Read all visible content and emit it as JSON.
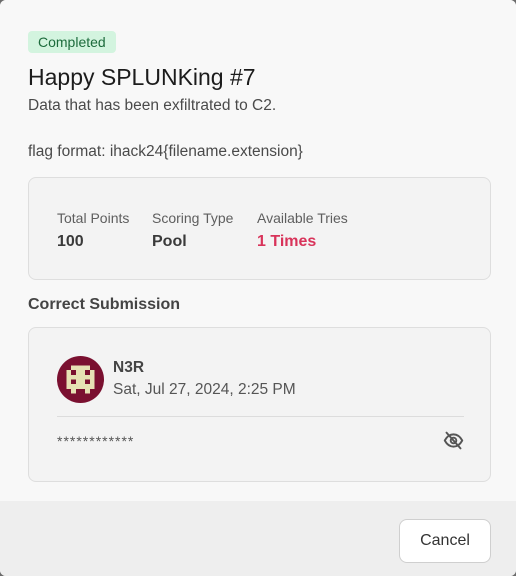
{
  "challenge": {
    "status_badge": "Completed",
    "title": "Happy SPLUNKing #7",
    "description": "Data that has been exfiltrated to C2.",
    "flag_format": "flag format: ihack24{filename.extension}"
  },
  "stats": {
    "total_points": {
      "label": "Total Points",
      "value": "100"
    },
    "scoring_type": {
      "label": "Scoring Type",
      "value": "Pool"
    },
    "available_tries": {
      "label": "Available Tries",
      "value": "1 Times"
    }
  },
  "submission": {
    "section_title": "Correct Submission",
    "user": "N3R",
    "timestamp": "Sat, Jul 27, 2024, 2:25 PM",
    "masked_answer": "************",
    "toggle_icon": "eye-off-icon"
  },
  "footer": {
    "cancel_label": "Cancel"
  },
  "colors": {
    "badge_bg": "#d3f4df",
    "badge_text": "#1d6b3c",
    "accent_red": "#d8335a",
    "avatar_primary": "#7a1030",
    "avatar_secondary": "#e6e1b4"
  }
}
